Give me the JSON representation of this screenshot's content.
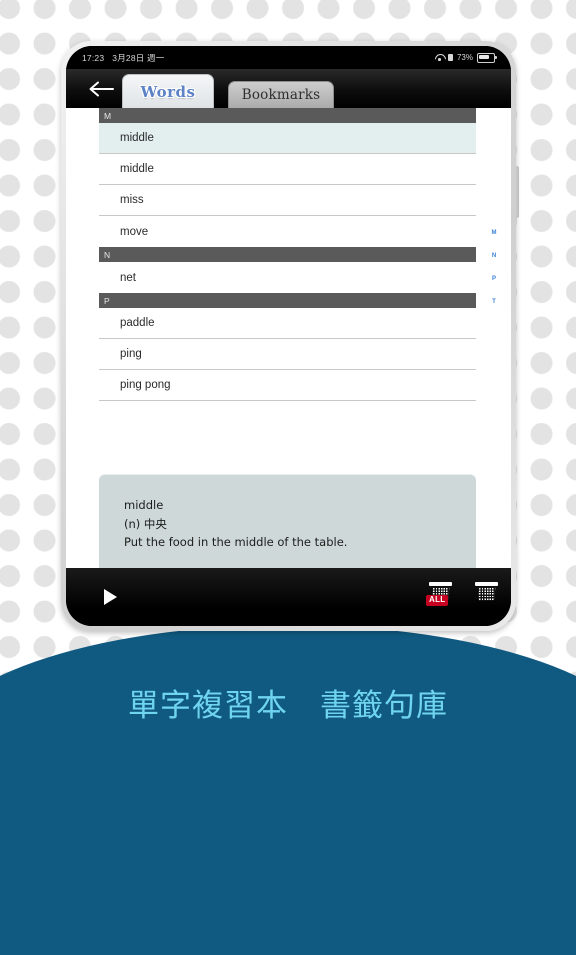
{
  "backdrop": {
    "dot_color": "#e3e3e3",
    "bg_color": "#ffffff"
  },
  "banner": {
    "text": "單字複習本　書籤句庫",
    "bg_color": "#105a82",
    "text_color": "#6fd4ee"
  },
  "device": {
    "statusbar": {
      "time": "17:23",
      "date": "3月28日 週一",
      "wifi_icon": "wifi-icon",
      "alarm_icon": "alarm-icon",
      "battery_percent": "73%",
      "battery_icon": "battery-icon"
    },
    "navigation": {
      "back_icon": "back-arrow-icon"
    },
    "tabs": [
      {
        "label": "Words",
        "active": true
      },
      {
        "label": "Bookmarks",
        "active": false
      }
    ],
    "word_list": {
      "sections": [
        {
          "letter": "M",
          "rows": [
            {
              "word": "middle",
              "selected": true
            },
            {
              "word": "middle",
              "selected": false
            },
            {
              "word": "miss",
              "selected": false
            },
            {
              "word": "move",
              "selected": false
            }
          ]
        },
        {
          "letter": "N",
          "rows": [
            {
              "word": "net",
              "selected": false
            }
          ]
        },
        {
          "letter": "P",
          "rows": [
            {
              "word": "paddle",
              "selected": false
            },
            {
              "word": "ping",
              "selected": false
            },
            {
              "word": "ping pong",
              "selected": false
            }
          ]
        }
      ],
      "index_letters": [
        "M",
        "N",
        "P",
        "T"
      ]
    },
    "definition": {
      "word": "middle",
      "part_of_speech_and_meaning": "(n) 中央",
      "example": "Put the food in the middle of the table."
    },
    "toolbar": {
      "play_icon": "play-icon",
      "delete_all_icon": "trash-all-icon",
      "delete_all_badge": "ALL",
      "delete_icon": "trash-icon"
    }
  }
}
